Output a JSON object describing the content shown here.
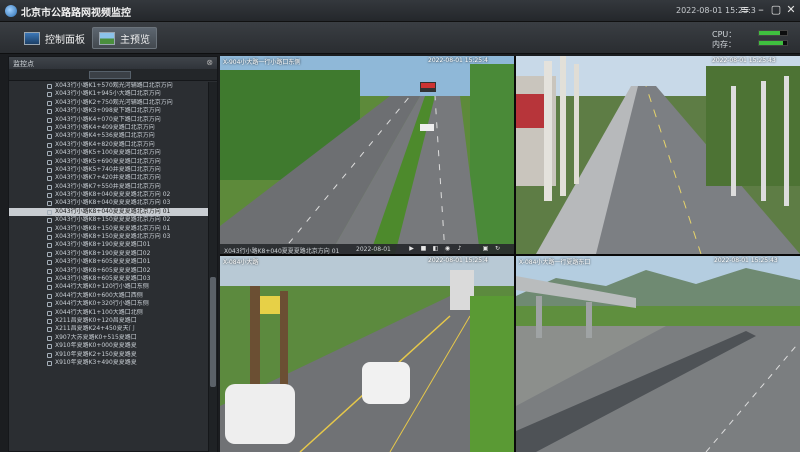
{
  "app": {
    "title": "北京市公路路网视频监控",
    "clock": "2022-08-01 15:25:3"
  },
  "window_controls": [
    "≡",
    "–",
    "▢",
    "✕"
  ],
  "toolbar": {
    "tabs": [
      {
        "label": "控制面板",
        "icon": "control-panel-icon",
        "active": false
      },
      {
        "label": "主预览",
        "icon": "preview-icon",
        "active": true
      }
    ],
    "cpu_label": "CPU：",
    "mem_label": "内存：",
    "cpu_level": 0.75,
    "mem_level": 0.85
  },
  "sidebar": {
    "header": "监控点",
    "items": [
      "X043行小路K1+570观光河辅路口北京方向",
      "X043行小路K1+945小大路口北京方向",
      "X043行小路K2+750观光河辅路口北京方向",
      "X043行小路K3+098夏下路口北京方向",
      "X043行小路K4+070夏下路口北京方向",
      "X043行小路K4+409夏路口北京方向",
      "X043行小路K4+536夏路口北京方向",
      "X043行小路K4+820夏路口北京方向",
      "X043行小路K5+100夏夏路口北京方向",
      "X043行小路K5+690夏夏路口北京方向",
      "X043行小路K5+740井夏路口北京方向",
      "X043行小路K7+420井夏路口北京方向",
      "X043行小路K7+550井夏路口北京方向",
      "X043行小路K8+040夏夏夏路北京方向 02",
      "X043行小路K8+040夏夏夏路北京方向 03",
      "X043行小路K8+040夏夏夏路北京方向 01",
      "X043行小路K8+150夏夏夏路北京方向 02",
      "X043行小路K8+150夏夏夏路北京方向 01",
      "X043行小路K8+150夏夏夏路北京方向 03",
      "X043行小路K8+190夏夏夏路口01",
      "X043行小路K8+190夏夏夏路口02",
      "X043行小路K8+605夏夏夏路口01",
      "X043行小路K8+605夏夏夏路口02",
      "X043行小路K8+605夏夏夏路口03",
      "X044行大路K0+120行小路口东侧",
      "X044行大路K0+600大路口西侧",
      "X044行大路K0+320行小路口东侧",
      "X044行大路K1+100大路口北侧",
      "X211昌夏路K0+120昌夏路口",
      "X211昌夏路K24+450夏天门",
      "X907大苏夏路K0+515夏路口",
      "X910年夏路K0+000夏夏路夏",
      "X910年夏路K2+150夏夏路夏",
      "X910年夏路K3+490夏夏路夏"
    ],
    "selected_index": 15
  },
  "tiles": [
    {
      "osd_title": "X-904小大路一行小路口东侧",
      "osd_time": "2022-08-01 15:25:4",
      "control_text": "X043行小路K8+040夏夏夏路北京方向 01",
      "control_time": "2022-08-01"
    },
    {
      "osd_title": "",
      "osd_time": "2022-08-01 15:25:43"
    },
    {
      "osd_title": "X-084小大路",
      "osd_time": "2022-08-01 15:25:4"
    },
    {
      "osd_title": "X-084小大路一行夏路东口",
      "osd_time": "2022-08-01 15:25:43"
    }
  ],
  "colors": {
    "selection_border": "#e33333",
    "meter_fill": "#3fbf3f"
  }
}
